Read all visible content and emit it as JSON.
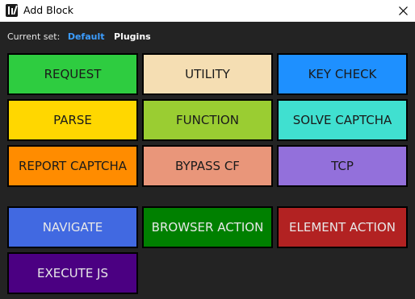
{
  "window": {
    "title": "Add Block"
  },
  "icons": {
    "app": "app-logo-icon",
    "close": "close-icon"
  },
  "set_selector": {
    "label": "Current set:",
    "options": [
      "Default",
      "Plugins"
    ],
    "selected": "Default"
  },
  "blocks": [
    {
      "label": "REQUEST",
      "color": "#2ecc40",
      "text_color": "#1a1a1a"
    },
    {
      "label": "UTILITY",
      "color": "#f5deb3",
      "text_color": "#1a1a1a"
    },
    {
      "label": "KEY CHECK",
      "color": "#1e90ff",
      "text_color": "#1a1a1a"
    },
    {
      "label": "PARSE",
      "color": "#ffd700",
      "text_color": "#1a1a1a"
    },
    {
      "label": "FUNCTION",
      "color": "#9acd32",
      "text_color": "#1a1a1a"
    },
    {
      "label": "SOLVE CAPTCHA",
      "color": "#40e0d0",
      "text_color": "#1a1a1a"
    },
    {
      "label": "REPORT CAPTCHA",
      "color": "#ff8c00",
      "text_color": "#1a1a1a"
    },
    {
      "label": "BYPASS CF",
      "color": "#e9967a",
      "text_color": "#1a1a1a"
    },
    {
      "label": "TCP",
      "color": "#9370db",
      "text_color": "#1a1a1a"
    }
  ],
  "browser_blocks": [
    {
      "label": "NAVIGATE",
      "color": "#4169e1",
      "text_color": "#e8e8e8"
    },
    {
      "label": "BROWSER ACTION",
      "color": "#008000",
      "text_color": "#e8e8e8"
    },
    {
      "label": "ELEMENT ACTION",
      "color": "#b22222",
      "text_color": "#e8e8e8"
    },
    {
      "label": "EXECUTE JS",
      "color": "#4b0082",
      "text_color": "#e8e8e8"
    }
  ]
}
